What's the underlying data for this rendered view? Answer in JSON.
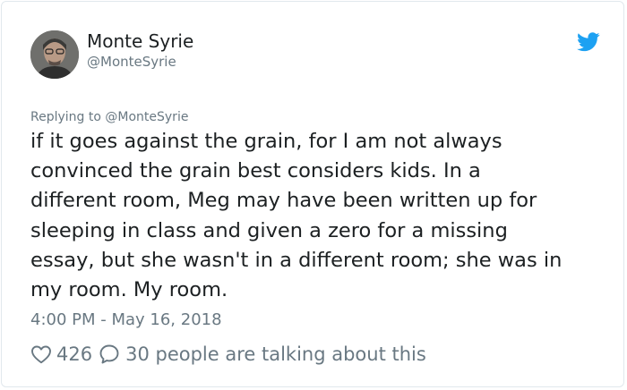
{
  "author": {
    "display_name": "Monte Syrie",
    "handle": "@MonteSyrie"
  },
  "reply": {
    "prefix": "Replying to ",
    "mention": "@MonteSyrie"
  },
  "tweet": {
    "lines": [
      "if it goes against the grain, for I am not always",
      "convinced the grain best considers kids. In a",
      "different room, Meg may have been written up for",
      "sleeping in class and given a zero for a missing",
      "essay, but she wasn't in a different room; she was in",
      "my room. My room."
    ],
    "timestamp": "4:00 PM - May 16, 2018"
  },
  "actions": {
    "likes": "426",
    "talking": "30 people are talking about this"
  },
  "icons": {
    "brand": "twitter-bird-icon",
    "like": "heart-icon",
    "reply": "speech-bubble-icon"
  },
  "colors": {
    "brand": "#1da1f2",
    "muted": "#697882",
    "text": "#1c2022",
    "border": "#e1e8ed"
  }
}
